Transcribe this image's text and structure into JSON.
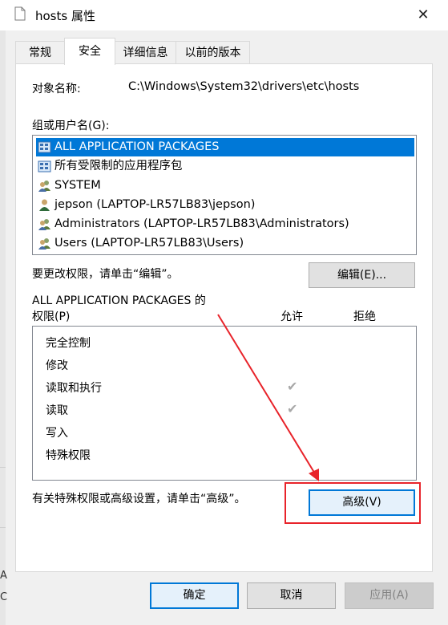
{
  "window": {
    "title": "hosts 属性",
    "close_glyph": "✕"
  },
  "tabs": [
    {
      "label": "常规",
      "active": false
    },
    {
      "label": "安全",
      "active": true
    },
    {
      "label": "详细信息",
      "active": false
    },
    {
      "label": "以前的版本",
      "active": false
    }
  ],
  "object": {
    "label": "对象名称:",
    "value": "C:\\Windows\\System32\\drivers\\etc\\hosts"
  },
  "groups": {
    "label": "组或用户名(G):",
    "items": [
      {
        "name": "ALL APPLICATION PACKAGES",
        "icon": "app-packages-icon",
        "selected": true
      },
      {
        "name": "所有受限制的应用程序包",
        "icon": "app-packages-icon",
        "selected": false
      },
      {
        "name": "SYSTEM",
        "icon": "users-group-icon",
        "selected": false
      },
      {
        "name": "jepson (LAPTOP-LR57LB83\\jepson)",
        "icon": "user-icon",
        "selected": false
      },
      {
        "name": "Administrators (LAPTOP-LR57LB83\\Administrators)",
        "icon": "users-group-icon",
        "selected": false
      },
      {
        "name": "Users (LAPTOP-LR57LB83\\Users)",
        "icon": "users-group-icon",
        "selected": false
      }
    ]
  },
  "edit": {
    "hint": "要更改权限，请单击“编辑”。",
    "button": "编辑(E)..."
  },
  "permissions": {
    "heading_line1": "ALL APPLICATION PACKAGES 的",
    "heading_line2": "权限(P)",
    "allow_label": "允许",
    "deny_label": "拒绝",
    "rows": [
      {
        "name": "完全控制",
        "allow": false,
        "deny": false
      },
      {
        "name": "修改",
        "allow": false,
        "deny": false
      },
      {
        "name": "读取和执行",
        "allow": true,
        "deny": false
      },
      {
        "name": "读取",
        "allow": true,
        "deny": false
      },
      {
        "name": "写入",
        "allow": false,
        "deny": false
      },
      {
        "name": "特殊权限",
        "allow": false,
        "deny": false
      }
    ],
    "check_glyph": "✔"
  },
  "advanced": {
    "hint": "有关特殊权限或高级设置，请单击“高级”。",
    "button": "高级(V)"
  },
  "footer": {
    "ok": "确定",
    "cancel": "取消",
    "apply": "应用(A)"
  },
  "background_fragments": {
    "frag1": "A",
    "frag2": "C"
  },
  "colors": {
    "selection": "#0078d7",
    "annotation": "#e8232a"
  }
}
